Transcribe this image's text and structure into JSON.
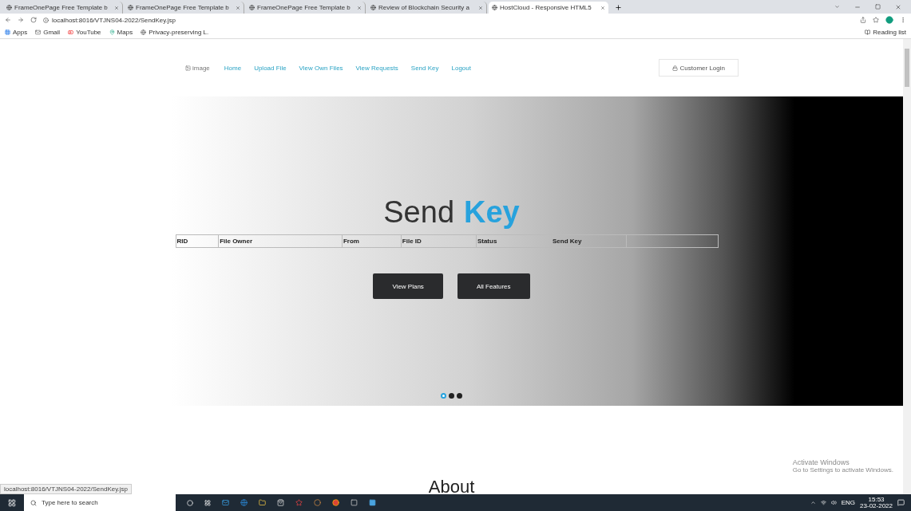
{
  "browser": {
    "tabs": [
      {
        "title": "FrameOnePage Free Template b",
        "selected": false
      },
      {
        "title": "FrameOnePage Free Template b",
        "selected": false
      },
      {
        "title": "FrameOnePage Free Template b",
        "selected": false
      },
      {
        "title": "Review of Blockchain Security a",
        "selected": false
      },
      {
        "title": "HostCloud - Responsive HTML5",
        "selected": true
      }
    ],
    "url": "localhost:8016/VTJNS04-2022/SendKey.jsp",
    "bookmarks": [
      "Apps",
      "Gmail",
      "YouTube",
      "Maps",
      "Privacy-preserving L."
    ],
    "reading_list": "Reading list",
    "status_link": "localhost:8016/VTJNS04-2022/SendKey.jsp"
  },
  "navbar": {
    "logo_alt": "image",
    "links": [
      "Home",
      "Upload File",
      "View Own Files",
      "View Requests",
      "Send Key",
      "Logout"
    ],
    "login_button": "Customer Login"
  },
  "hero": {
    "heading": "Send",
    "heading_accent": "Key",
    "table": {
      "columns": [
        "RID",
        "File Owner",
        "From",
        "File ID",
        "Status",
        "Send Key"
      ]
    },
    "buttons": [
      "View Plans",
      "All Features"
    ],
    "dots": [
      {
        "selected": true
      },
      {
        "selected": false
      },
      {
        "selected": false
      }
    ]
  },
  "about": {
    "heading": "About"
  },
  "os_notice": {
    "title": "Activate Windows",
    "text": "Go to Settings to activate Windows."
  },
  "taskbar": {
    "search_placeholder": "Type here to search",
    "language": "ENG",
    "time": "15:53",
    "date": "23-02-2022"
  }
}
